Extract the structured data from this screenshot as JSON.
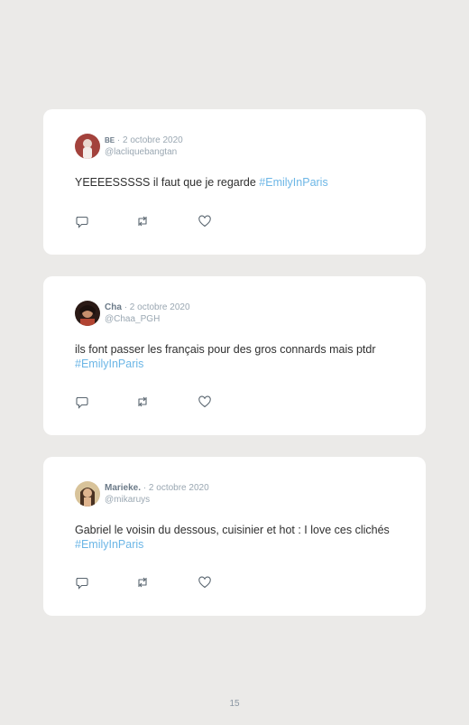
{
  "tweets": [
    {
      "display_name": "BE",
      "date": "· 2 octobre 2020",
      "handle": "@lacliquebangtan",
      "text": "YEEEESSSSS il faut que je regarde ",
      "hashtag": "#EmilyInParis"
    },
    {
      "display_name": "Cha",
      "date": "· 2 octobre 2020",
      "handle": "@Chaa_PGH",
      "text": "ils font passer les français pour des gros connards mais ptdr ",
      "hashtag": "#EmilyInParis"
    },
    {
      "display_name": "Marieke.",
      "date": "· 2 octobre 2020",
      "handle": "@mikaruys",
      "text": "Gabriel le voisin du dessous, cuisinier et hot : I love ces clichés ",
      "hashtag": "#EmilyInParis"
    }
  ],
  "icons": {
    "reply": "reply-icon",
    "retweet": "retweet-icon",
    "like": "heart-icon"
  },
  "colors": {
    "background": "#ebeae8",
    "card": "#ffffff",
    "hashtag": "#6cb6e6",
    "meta": "#9aa7b2"
  },
  "page_number": "15"
}
